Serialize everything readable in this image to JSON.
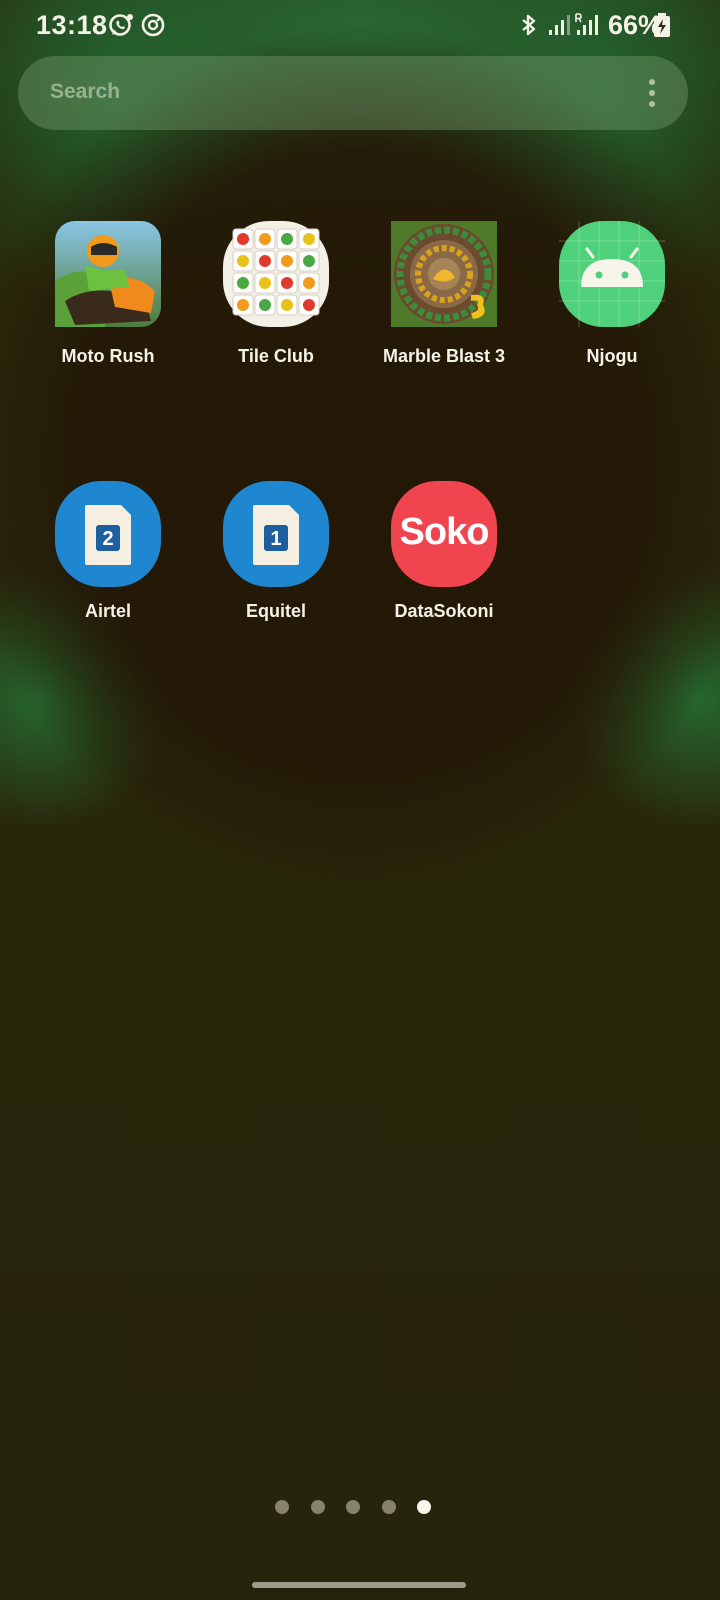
{
  "status_bar": {
    "time": "13:18",
    "battery": "66%",
    "icons": [
      "whatsapp-icon",
      "sync-icon",
      "bluetooth-icon",
      "signal-icon",
      "signal-roaming-icon",
      "battery-charging-icon"
    ]
  },
  "search": {
    "placeholder": "Search"
  },
  "apps": [
    {
      "label": "Moto Rush",
      "icon": "moto-rush-icon"
    },
    {
      "label": "Tile Club",
      "icon": "tile-club-icon"
    },
    {
      "label": "Marble Blast 3",
      "icon": "marble-blast-icon"
    },
    {
      "label": "Njogu",
      "icon": "android-icon"
    },
    {
      "label": "Airtel",
      "icon": "sim-2-icon",
      "badge": "2"
    },
    {
      "label": "Equitel",
      "icon": "sim-1-icon",
      "badge": "1"
    },
    {
      "label": "DataSokoni",
      "icon": "soko-icon",
      "wordmark": "Soko"
    }
  ],
  "pager": {
    "pages": 5,
    "current": 5
  },
  "colors": {
    "sim_blue": "#1e87d0",
    "android_green": "#4fd07a",
    "soko_red": "#f0444e"
  }
}
